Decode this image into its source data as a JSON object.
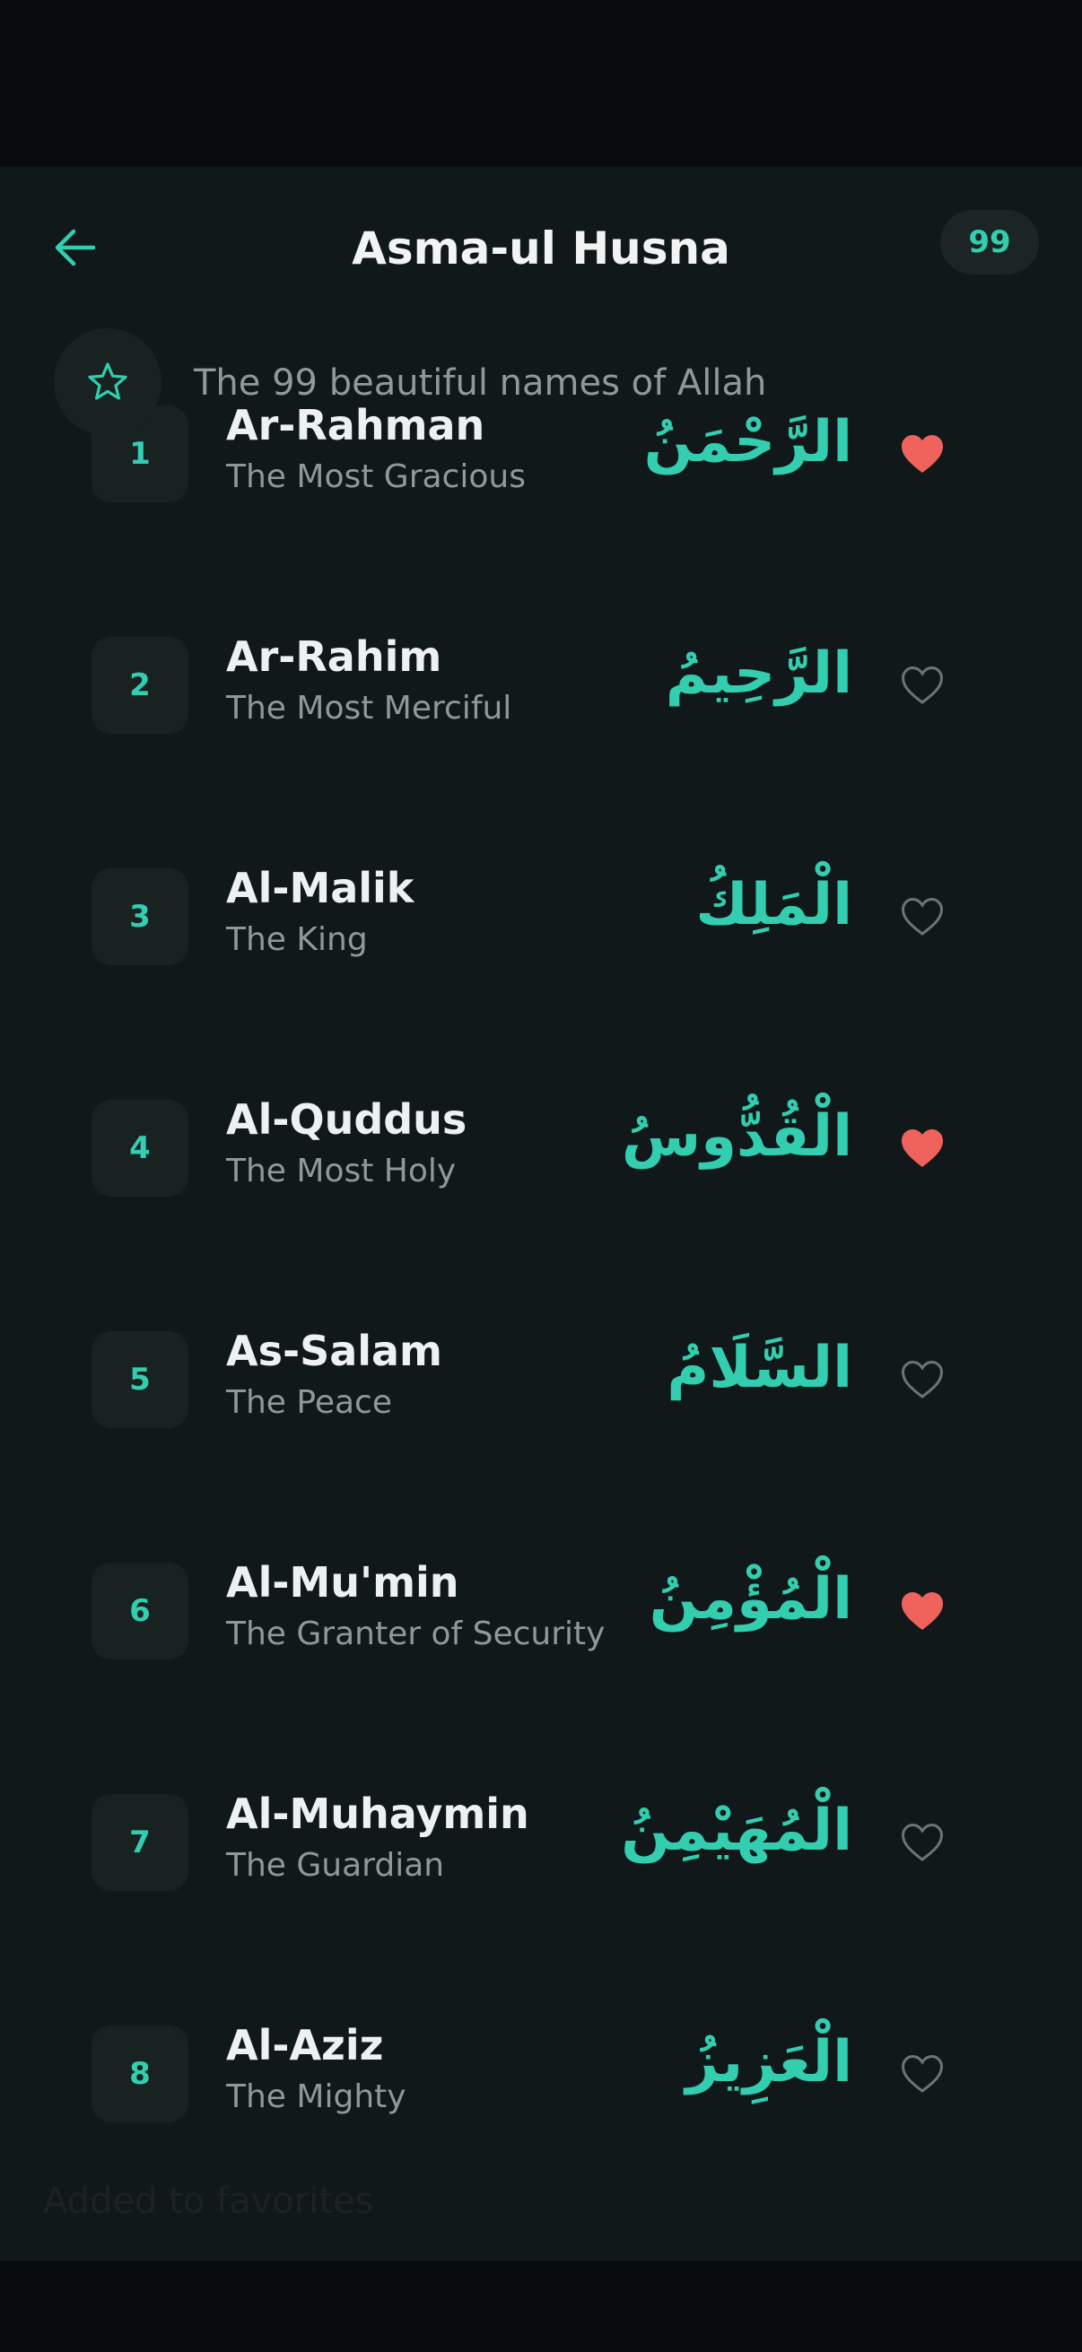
{
  "header": {
    "title": "Asma-ul Husna",
    "count": "99",
    "subtitle": "The 99 beautiful names of Allah"
  },
  "colors": {
    "accent": "#33cdb0",
    "favorite": "#f0635c",
    "background": "#111819"
  },
  "icons": {
    "back": "arrow-left-icon",
    "subtitle": "star-icon",
    "favorite_on": "heart-filled-icon",
    "favorite_off": "heart-outline-icon"
  },
  "names": [
    {
      "number": "1",
      "transliteration": "Ar-Rahman",
      "meaning": "The Most Gracious",
      "arabic": "الرَّحْمَنُ",
      "favorite": true
    },
    {
      "number": "2",
      "transliteration": "Ar-Rahim",
      "meaning": "The Most Merciful",
      "arabic": "الرَّحِيمُ",
      "favorite": false
    },
    {
      "number": "3",
      "transliteration": "Al-Malik",
      "meaning": "The King",
      "arabic": "الْمَلِكُ",
      "favorite": false
    },
    {
      "number": "4",
      "transliteration": "Al-Quddus",
      "meaning": "The Most Holy",
      "arabic": "الْقُدُّوسُ",
      "favorite": true
    },
    {
      "number": "5",
      "transliteration": "As-Salam",
      "meaning": "The Peace",
      "arabic": "السَّلَامُ",
      "favorite": false
    },
    {
      "number": "6",
      "transliteration": "Al-Mu'min",
      "meaning": "The Granter of Security",
      "arabic": "الْمُؤْمِنُ",
      "favorite": true
    },
    {
      "number": "7",
      "transliteration": "Al-Muhaymin",
      "meaning": "The Guardian",
      "arabic": "الْمُهَيْمِنُ",
      "favorite": false
    },
    {
      "number": "8",
      "transliteration": "Al-Aziz",
      "meaning": "The Mighty",
      "arabic": "الْعَزِيزُ",
      "favorite": false
    }
  ],
  "toast": {
    "message": "Added to favorites"
  }
}
